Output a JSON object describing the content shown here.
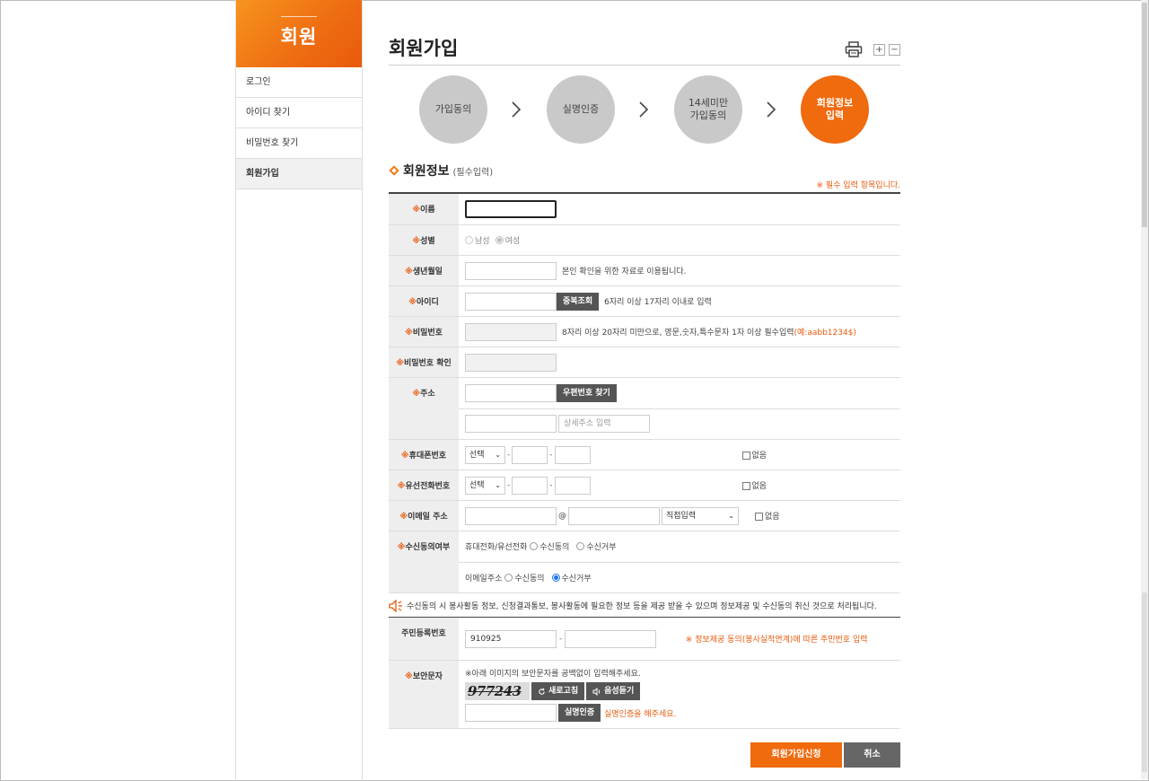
{
  "sidebar": {
    "title": "회원",
    "items": [
      {
        "label": "로그인"
      },
      {
        "label": "아이디 찾기"
      },
      {
        "label": "비밀번호 찾기"
      },
      {
        "label": "회원가입",
        "active": true
      }
    ]
  },
  "header": {
    "title": "회원가입",
    "icons": [
      "print-icon",
      "zoom-in-icon",
      "zoom-out-icon"
    ],
    "zoom_in": "+",
    "zoom_out": "−"
  },
  "steps": [
    {
      "label": "가입동의"
    },
    {
      "label": "실명인증"
    },
    {
      "label": "14세미만\n가입동의"
    },
    {
      "label": "회원정보\n입력",
      "active": true
    }
  ],
  "section": {
    "title": "회원정보",
    "subtitle": "(필수입력)",
    "required_note": "※ 필수 입력 항목입니다."
  },
  "form": {
    "star": "※",
    "name": {
      "label": "이름",
      "value": ""
    },
    "gender": {
      "label": "성별",
      "options": [
        "남성",
        "여성"
      ],
      "selected": "여성"
    },
    "birth": {
      "label": "생년월일",
      "value": "",
      "help": "본인 확인을 위한 자료로 이용됩니다."
    },
    "userid": {
      "label": "아이디",
      "value": "",
      "button": "중복조회",
      "help": "6자리 이상 17자리 이내로 입력"
    },
    "password": {
      "label": "비밀번호",
      "help": "8자리 이상 20자리 미만으로, 영문,숫자,특수문자 1자 이상 필수입력",
      "example": "(예:aabb1234$)"
    },
    "password_confirm": {
      "label": "비밀번호 확인"
    },
    "address": {
      "label": "주소",
      "button": "우편번호 찾기",
      "detail_placeholder": "상세주소 입력"
    },
    "mobile": {
      "label": "휴대폰번호",
      "select": "선택",
      "none_label": "없음"
    },
    "phone": {
      "label": "유선전화번호",
      "select": "선택",
      "none_label": "없음"
    },
    "email": {
      "label": "이메일 주소",
      "at": "@",
      "domain_select": "직접입력",
      "none_label": "없음"
    },
    "consent": {
      "label": "수신동의여부",
      "phone_label": "휴대전화/유선전화",
      "email_label": "이메일주소",
      "agree": "수신동의",
      "reject": "수신거부",
      "phone_selected": "",
      "email_selected": "수신거부"
    }
  },
  "notice": "수신동의 시 봉사활동 정보, 신청결과통보, 봉사활동에 필요한 정보 등을 제공 받을 수 있으며 정보제공 및 수신동의 취신 것으로 처리됩니다.",
  "form2": {
    "rrn": {
      "label": "주민등록번호",
      "value": "910925",
      "note": "※ 정보제공 동의(봉사실적연계)에 따른 주민번호 입력"
    },
    "captcha": {
      "label": "보안문자",
      "help": "※아래 이미지의 보안문자를 공백없이 입력해주세요.",
      "image_text": "977243",
      "refresh": "새로고침",
      "audio": "음성듣기",
      "verify": "실명인증",
      "verify_note": "실명인증을 해주세요."
    }
  },
  "actions": {
    "submit": "회원가입신청",
    "cancel": "취소"
  },
  "colors": {
    "accent": "#f06a0e",
    "step_inactive": "#c9c9c9",
    "label_bg": "#eeeeee",
    "dark_button": "#555555"
  }
}
